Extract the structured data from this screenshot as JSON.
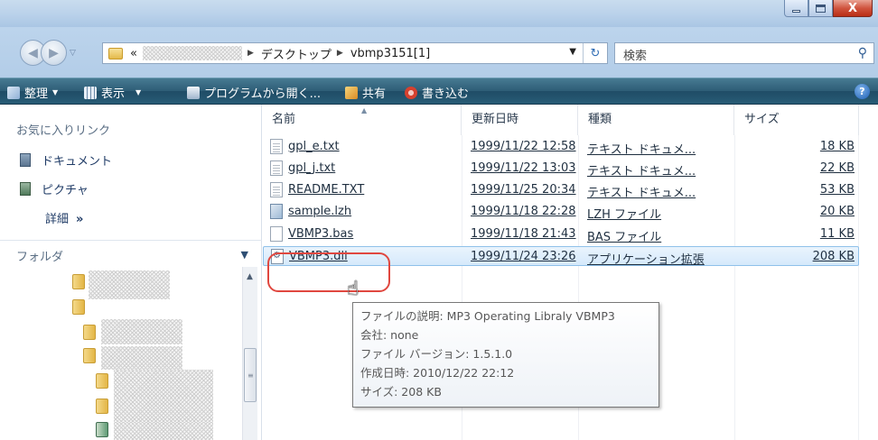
{
  "window": {
    "minimize_glyph": "—",
    "maximize_glyph": "▭",
    "close_glyph": "X"
  },
  "address": {
    "overflow_label": "«",
    "crumbs": [
      "デスクトップ",
      "vbmp3151[1]"
    ],
    "search_placeholder": "検索"
  },
  "toolbar": {
    "organize": "整理",
    "views": "表示",
    "open_with": "プログラムから開く...",
    "share": "共有",
    "burn": "書き込む",
    "help": "?"
  },
  "nav": {
    "favorites_title": "お気に入りリンク",
    "favorites": [
      "ドキュメント",
      "ピクチャ"
    ],
    "more_label": "詳細",
    "more_arrows": "»",
    "folders_title": "フォルダ"
  },
  "list": {
    "columns": {
      "name": "名前",
      "date": "更新日時",
      "type": "種類",
      "size": "サイズ"
    },
    "files": [
      {
        "name": "gpl_e.txt",
        "date": "1999/11/22 12:58",
        "type": "テキスト ドキュメ...",
        "size": "18 KB",
        "icon": "text-file-icon"
      },
      {
        "name": "gpl_j.txt",
        "date": "1999/11/22 13:03",
        "type": "テキスト ドキュメ...",
        "size": "22 KB",
        "icon": "text-file-icon"
      },
      {
        "name": "README.TXT",
        "date": "1999/11/25 20:34",
        "type": "テキスト ドキュメ...",
        "size": "53 KB",
        "icon": "text-file-icon"
      },
      {
        "name": "sample.lzh",
        "date": "1999/11/18 22:28",
        "type": "LZH ファイル",
        "size": "20 KB",
        "icon": "archive-file-icon"
      },
      {
        "name": "VBMP3.bas",
        "date": "1999/11/18 21:43",
        "type": "BAS ファイル",
        "size": "11 KB",
        "icon": "file-icon"
      },
      {
        "name": "VBMP3.dll",
        "date": "1999/11/24 23:26",
        "type": "アプリケーション拡張",
        "size": "208 KB",
        "icon": "dll-file-icon"
      }
    ]
  },
  "tooltip": {
    "description": "ファイルの説明: MP3 Operating Libraly VBMP3",
    "company": "会社: none",
    "version": "ファイル バージョン: 1.5.1.0",
    "created": "作成日時: 2010/12/22 22:12",
    "size": "サイズ: 208 KB"
  },
  "colors": {
    "toolbar": "#2d5d76",
    "selection": "#d5e9fb",
    "highlight_ring": "#e0473f",
    "close_button": "#c9442b"
  }
}
